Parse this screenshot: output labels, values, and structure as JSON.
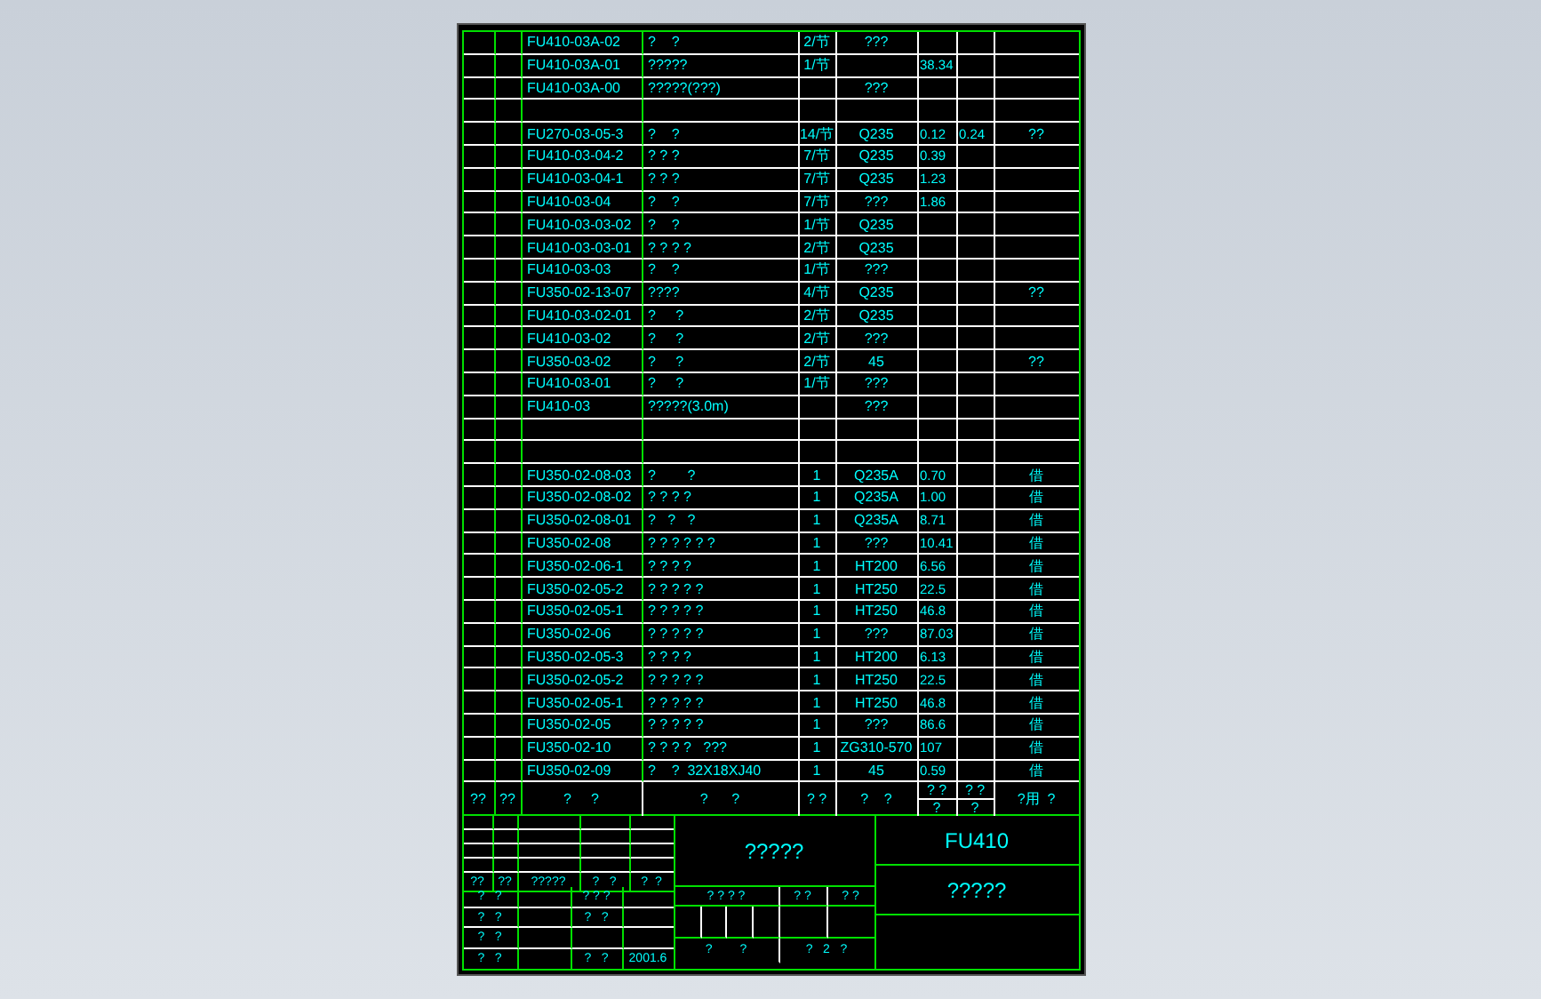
{
  "parts": [
    {
      "kind": "part",
      "code": "FU410-03A-02",
      "name": "?    ?",
      "qty": "2/节",
      "material": "???"
    },
    {
      "kind": "part",
      "code": "FU410-03A-01",
      "name": "?????",
      "qty": "1/节",
      "unit_weight": "38.34"
    },
    {
      "kind": "part",
      "code": "FU410-03A-00",
      "name": "?????(???)",
      "material": "???"
    },
    {
      "kind": "blank"
    },
    {
      "kind": "part",
      "code": "FU270-03-05-3",
      "name": "?    ?",
      "qty": "14/节",
      "material": "Q235",
      "unit_weight": "0.12",
      "total_weight": "0.24",
      "remark": "??"
    },
    {
      "kind": "part",
      "code": "FU410-03-04-2",
      "name": "? ? ?",
      "qty": "7/节",
      "material": "Q235",
      "unit_weight": "0.39"
    },
    {
      "kind": "part",
      "code": "FU410-03-04-1",
      "name": "? ? ?",
      "qty": "7/节",
      "material": "Q235",
      "unit_weight": "1.23"
    },
    {
      "kind": "part",
      "code": "FU410-03-04",
      "name": "?    ?",
      "qty": "7/节",
      "material": "???",
      "unit_weight": "1.86"
    },
    {
      "kind": "part",
      "code": "FU410-03-03-02",
      "name": "?    ?",
      "qty": "1/节",
      "material": "Q235"
    },
    {
      "kind": "part",
      "code": "FU410-03-03-01",
      "name": "? ? ? ?",
      "qty": "2/节",
      "material": "Q235"
    },
    {
      "kind": "part",
      "code": "FU410-03-03",
      "name": "?    ?",
      "qty": "1/节",
      "material": "???"
    },
    {
      "kind": "part",
      "code": "FU350-02-13-07",
      "name": "????",
      "qty": "4/节",
      "material": "Q235",
      "remark": "??"
    },
    {
      "kind": "part",
      "code": "FU410-03-02-01",
      "name": "?     ?",
      "qty": "2/节",
      "material": "Q235"
    },
    {
      "kind": "part",
      "code": "FU410-03-02",
      "name": "?     ?",
      "qty": "2/节",
      "material": "???"
    },
    {
      "kind": "part",
      "code": "FU350-03-02",
      "name": "?     ?",
      "qty": "2/节",
      "material": "45",
      "remark": "??"
    },
    {
      "kind": "part",
      "code": "FU410-03-01",
      "name": "?     ?",
      "qty": "1/节",
      "material": "???"
    },
    {
      "kind": "part",
      "code": "FU410-03",
      "name": "?????(3.0m)",
      "material": "???"
    },
    {
      "kind": "blank"
    },
    {
      "kind": "blank"
    },
    {
      "kind": "part",
      "code": "FU350-02-08-03",
      "name": "?        ?",
      "qty": "1",
      "material": "Q235A",
      "unit_weight": "0.70",
      "remark": "借"
    },
    {
      "kind": "part",
      "code": "FU350-02-08-02",
      "name": "? ? ? ?",
      "qty": "1",
      "material": "Q235A",
      "unit_weight": "1.00",
      "remark": "借"
    },
    {
      "kind": "part",
      "code": "FU350-02-08-01",
      "name": "?   ?   ?",
      "qty": "1",
      "material": "Q235A",
      "unit_weight": "8.71",
      "remark": "借"
    },
    {
      "kind": "part",
      "code": "FU350-02-08",
      "name": "? ? ? ? ? ?",
      "qty": "1",
      "material": "???",
      "unit_weight": "10.41",
      "remark": "借"
    },
    {
      "kind": "part",
      "code": "FU350-02-06-1",
      "name": "? ? ? ?",
      "qty": "1",
      "material": "HT200",
      "unit_weight": "6.56",
      "remark": "借"
    },
    {
      "kind": "part",
      "code": "FU350-02-05-2",
      "name": "? ? ? ? ?",
      "qty": "1",
      "material": "HT250",
      "unit_weight": "22.5",
      "remark": "借"
    },
    {
      "kind": "part",
      "code": "FU350-02-05-1",
      "name": "? ? ? ? ?",
      "qty": "1",
      "material": "HT250",
      "unit_weight": "46.8",
      "remark": "借"
    },
    {
      "kind": "part",
      "code": "FU350-02-06",
      "name": "? ? ? ? ?",
      "qty": "1",
      "material": "???",
      "unit_weight": "87.03",
      "remark": "借"
    },
    {
      "kind": "part",
      "code": "FU350-02-05-3",
      "name": "? ? ? ?",
      "qty": "1",
      "material": "HT200",
      "unit_weight": "6.13",
      "remark": "借"
    },
    {
      "kind": "part",
      "code": "FU350-02-05-2",
      "name": "? ? ? ? ?",
      "qty": "1",
      "material": "HT250",
      "unit_weight": "22.5",
      "remark": "借"
    },
    {
      "kind": "part",
      "code": "FU350-02-05-1",
      "name": "? ? ? ? ?",
      "qty": "1",
      "material": "HT250",
      "unit_weight": "46.8",
      "remark": "借"
    },
    {
      "kind": "part",
      "code": "FU350-02-05",
      "name": "? ? ? ? ?",
      "qty": "1",
      "material": "???",
      "unit_weight": "86.6",
      "remark": "借"
    },
    {
      "kind": "part",
      "code": "FU350-02-10",
      "name": "? ? ? ?   ???",
      "qty": "1",
      "material": "ZG310-570",
      "unit_weight": "107",
      "remark": "借"
    },
    {
      "kind": "part",
      "code": "FU350-02-09",
      "name": "?    ?  32X18XJ40",
      "qty": "1",
      "material": "45",
      "unit_weight": "0.59",
      "remark": "借"
    }
  ],
  "header": {
    "col_1": "??",
    "col_2": "??",
    "col_3": "?     ?",
    "col_4": "?      ?",
    "col_5": "? ?",
    "col_6": "?    ?",
    "col_7_top": "? ?",
    "col_7_bottom": "?",
    "col_8_top": "? ?",
    "col_8_bottom": "?",
    "col_9": "?用  ?"
  },
  "title_block": {
    "sign_labels": [
      "??",
      "??",
      "?????",
      "?   ?",
      "?  ?"
    ],
    "sign_rows": [
      [
        "?   ?",
        "",
        "? ? ?",
        ""
      ],
      [
        "?   ?",
        "",
        "?   ?",
        ""
      ],
      [
        "?   ?",
        "",
        "",
        ""
      ],
      [
        "?   ?",
        "",
        "?   ?",
        "2001.6"
      ]
    ],
    "title": "?????",
    "stage_labels": [
      "? ? ? ?",
      "? ?",
      "? ?"
    ],
    "scale_row": [
      "?        ?",
      "?   2   ?"
    ],
    "drawing_number": "FU410",
    "drawing_name": "?????"
  }
}
